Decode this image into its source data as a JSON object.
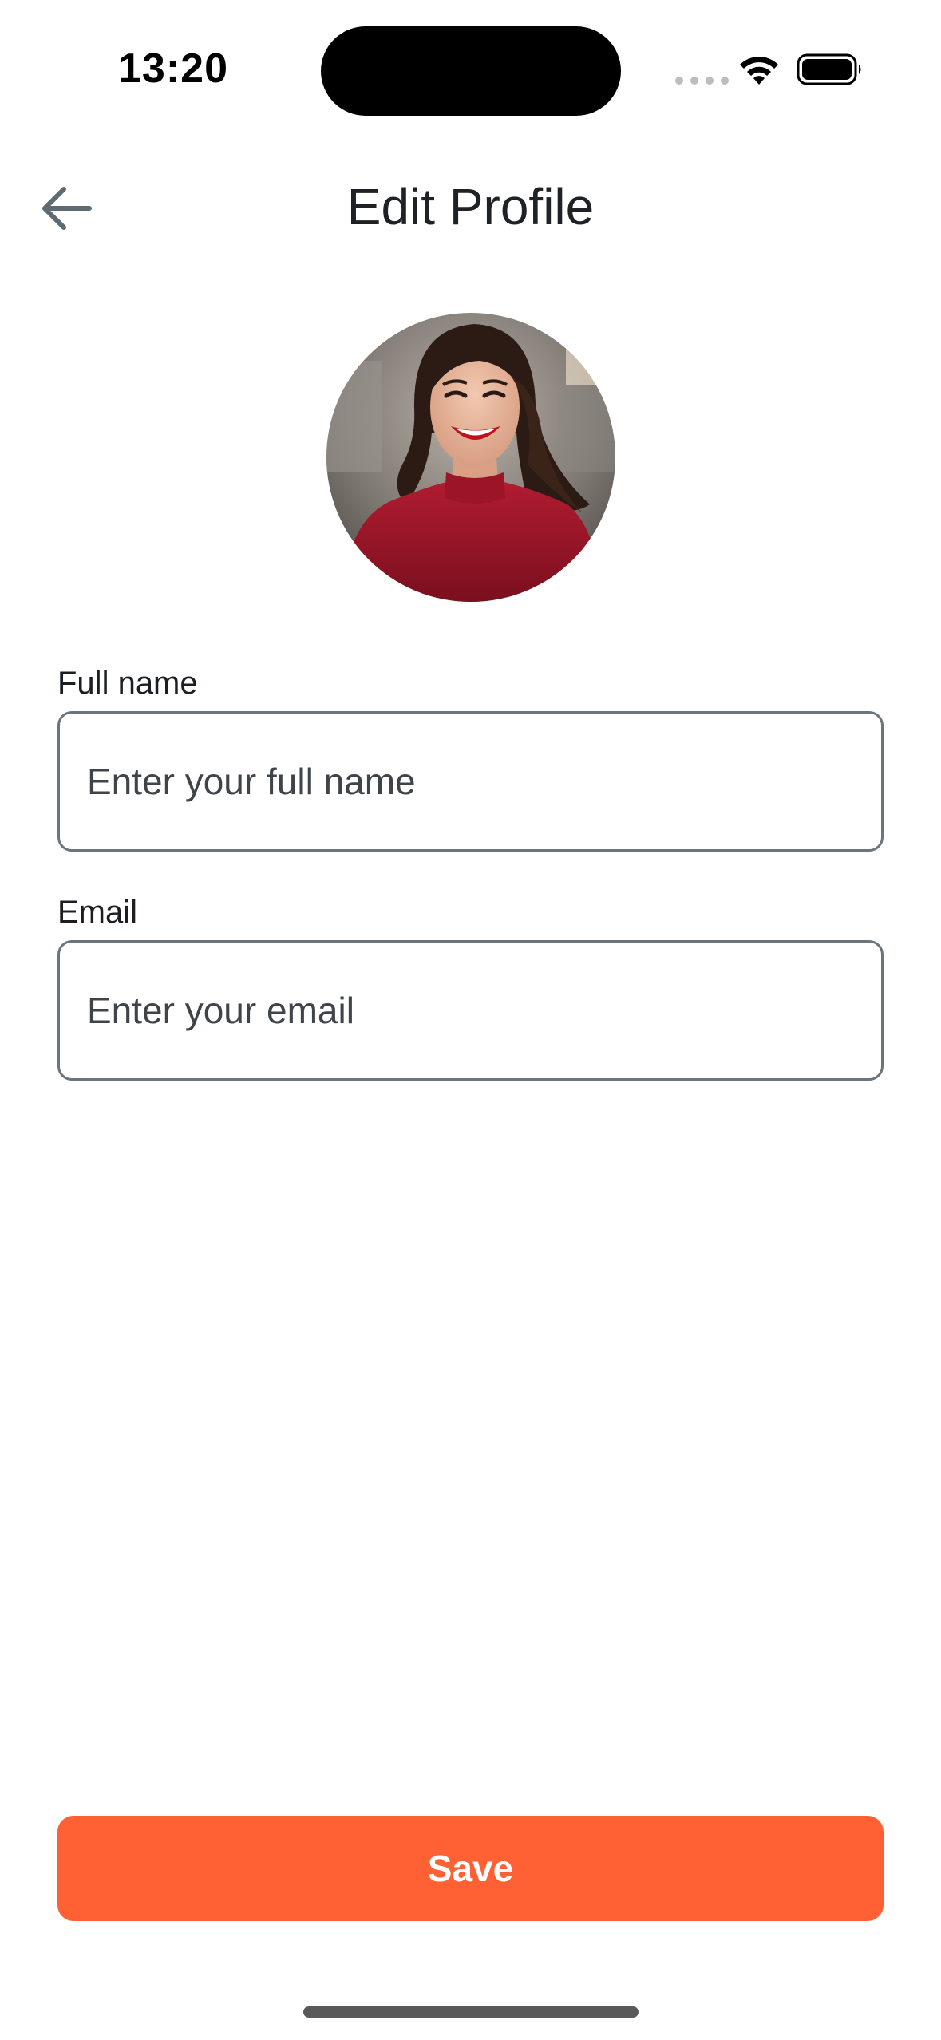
{
  "status_bar": {
    "time": "13:20",
    "wifi_icon": "wifi-icon",
    "battery_icon": "battery-full-icon"
  },
  "header": {
    "back_icon": "arrow-left-icon",
    "title": "Edit Profile"
  },
  "profile": {
    "avatar": "profile-photo-avatar"
  },
  "form": {
    "full_name": {
      "label": "Full name",
      "value": "",
      "placeholder": "Enter your full name"
    },
    "email": {
      "label": "Email",
      "value": "",
      "placeholder": "Enter your email"
    }
  },
  "actions": {
    "save_label": "Save"
  },
  "colors": {
    "accent": "#ff6034",
    "input_border": "#6b757c",
    "back_icon": "#5f6b72"
  }
}
